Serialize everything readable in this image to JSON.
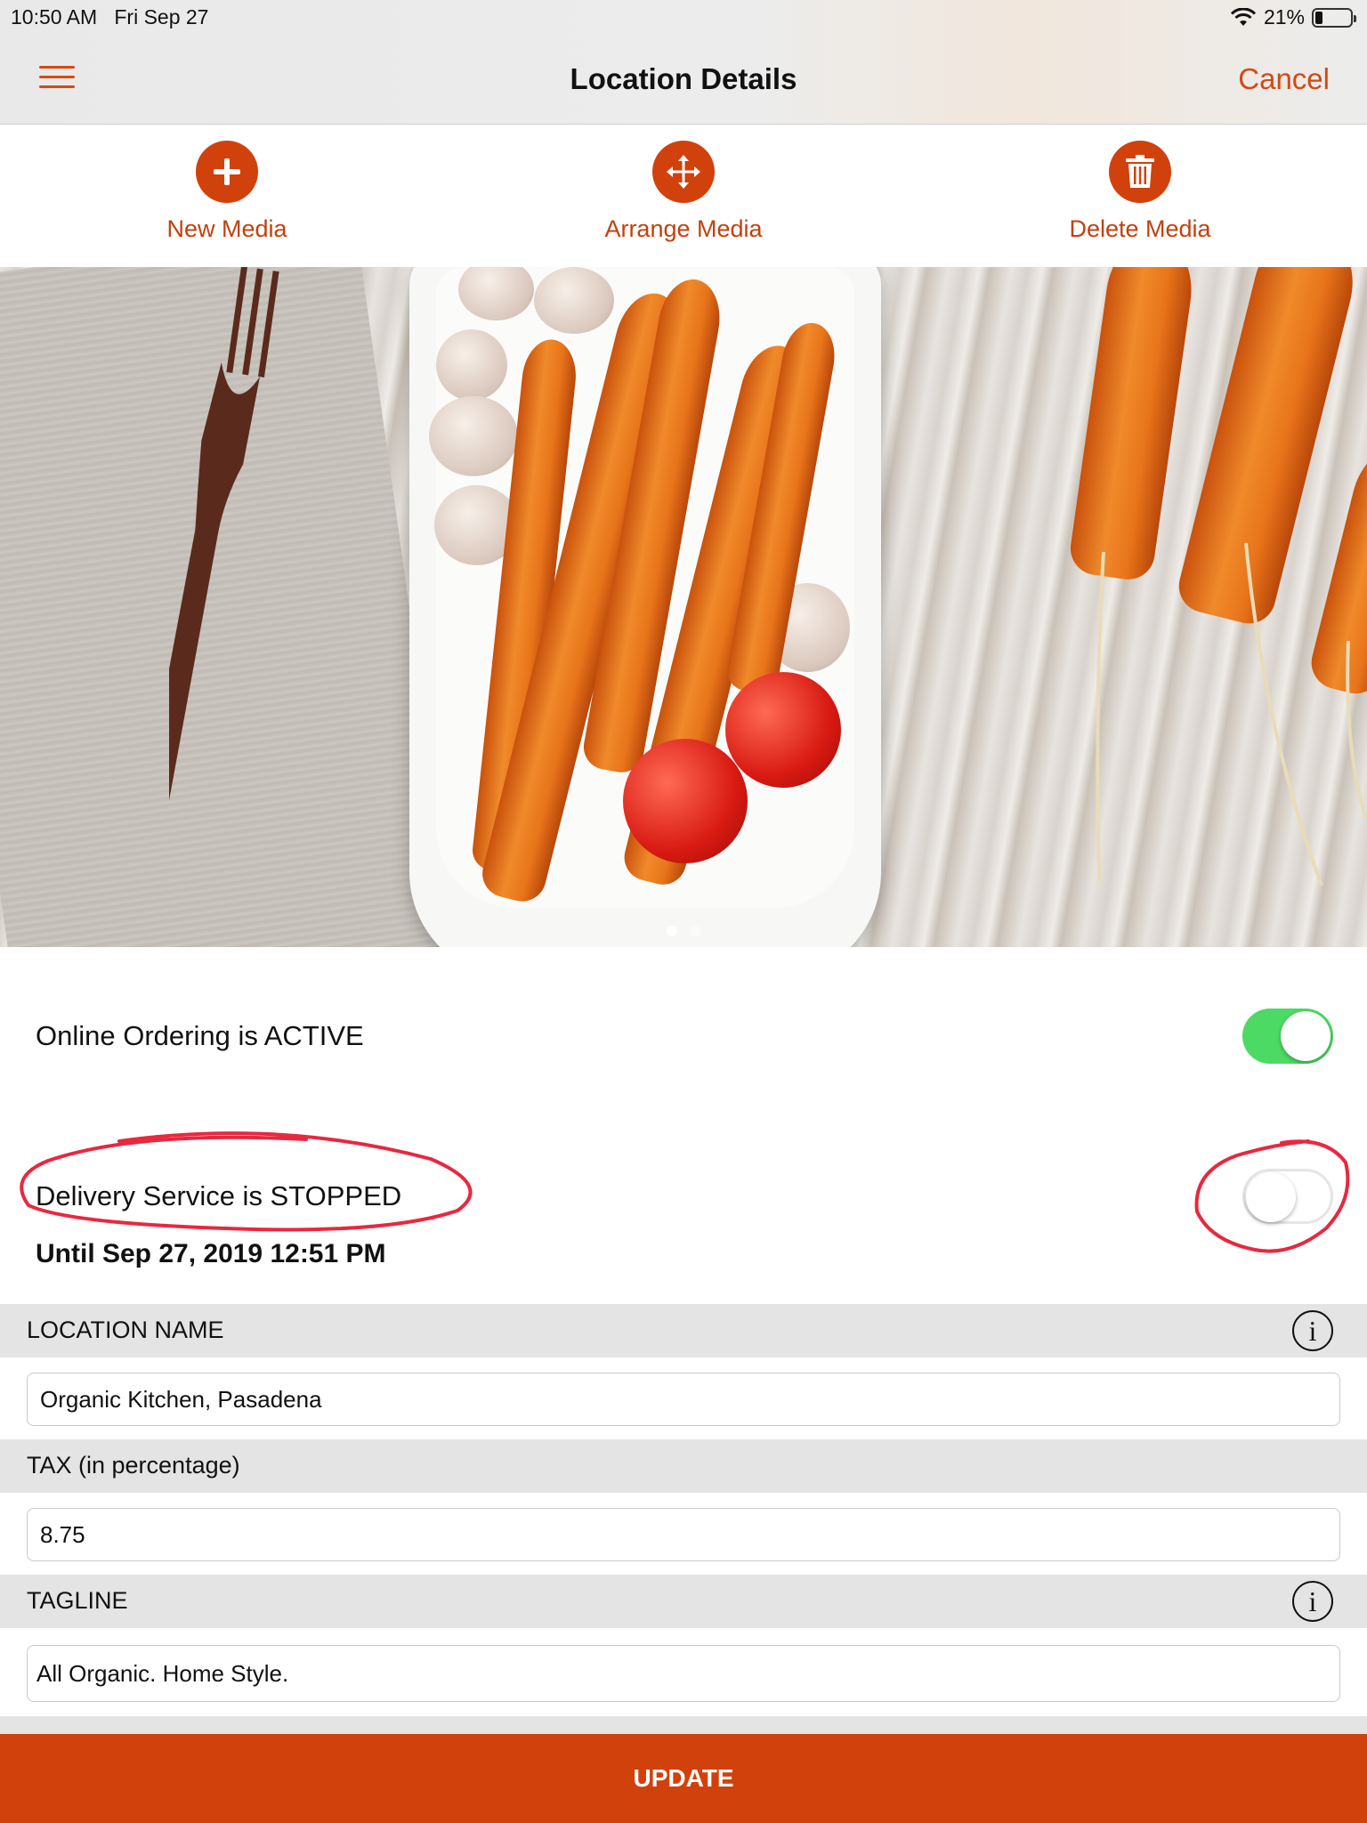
{
  "status_bar": {
    "time": "10:50 AM",
    "date": "Fri Sep 27",
    "battery_percent": "21%",
    "battery_level": 0.21,
    "wifi_icon": "wifi-icon"
  },
  "nav": {
    "title": "Location Details",
    "cancel_label": "Cancel",
    "menu_icon": "hamburger-menu-icon"
  },
  "media_actions": [
    {
      "label": "New Media",
      "icon": "plus-icon"
    },
    {
      "label": "Arrange Media",
      "icon": "move-arrows-icon"
    },
    {
      "label": "Delete Media",
      "icon": "trash-icon"
    }
  ],
  "gallery": {
    "page_count": 2,
    "current_page": 1
  },
  "online_ordering": {
    "label": "Online Ordering is ACTIVE",
    "enabled": true
  },
  "delivery_service": {
    "label": "Delivery Service is STOPPED",
    "enabled": false,
    "until": "Until Sep 27, 2019 12:51 PM"
  },
  "form": {
    "location_name": {
      "header": "LOCATION NAME",
      "value": "Organic Kitchen, Pasadena",
      "info_icon": "info-icon"
    },
    "tax": {
      "header": "TAX (in percentage)",
      "value": "8.75"
    },
    "tagline": {
      "header": "TAGLINE",
      "value": "All Organic. Home Style.",
      "info_icon": "info-icon"
    }
  },
  "update_label": "UPDATE",
  "colors": {
    "accent": "#d1410c",
    "toggle_on": "#4cd964",
    "annotation": "#e8283f",
    "section_bg": "#e4e4e4"
  }
}
